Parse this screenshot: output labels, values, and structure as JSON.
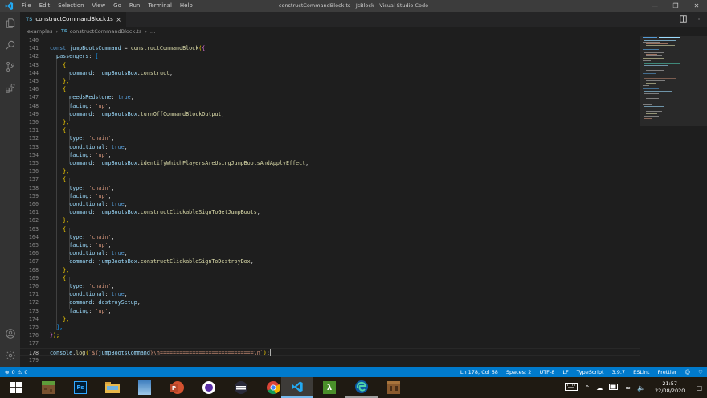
{
  "window": {
    "title": "constructCommandBlock.ts - JsBlock - Visual Studio Code",
    "menu": [
      "File",
      "Edit",
      "Selection",
      "View",
      "Go",
      "Run",
      "Terminal",
      "Help"
    ]
  },
  "tab": {
    "icon_text": "TS",
    "label": "constructCommandBlock.ts"
  },
  "breadcrumb": {
    "folder": "examples",
    "icon_text": "TS",
    "file": "constructCommandBlock.ts",
    "trail": "…"
  },
  "editor": {
    "lines": [
      {
        "n": "140"
      },
      {
        "n": "141"
      },
      {
        "n": "142"
      },
      {
        "n": "143"
      },
      {
        "n": "144"
      },
      {
        "n": "145"
      },
      {
        "n": "146"
      },
      {
        "n": "147"
      },
      {
        "n": "148"
      },
      {
        "n": "149"
      },
      {
        "n": "150"
      },
      {
        "n": "151"
      },
      {
        "n": "152"
      },
      {
        "n": "153"
      },
      {
        "n": "154"
      },
      {
        "n": "155"
      },
      {
        "n": "156"
      },
      {
        "n": "157"
      },
      {
        "n": "158"
      },
      {
        "n": "159"
      },
      {
        "n": "160"
      },
      {
        "n": "161"
      },
      {
        "n": "162"
      },
      {
        "n": "163"
      },
      {
        "n": "164"
      },
      {
        "n": "165"
      },
      {
        "n": "166"
      },
      {
        "n": "167"
      },
      {
        "n": "168"
      },
      {
        "n": "169"
      },
      {
        "n": "170"
      },
      {
        "n": "171"
      },
      {
        "n": "172"
      },
      {
        "n": "173"
      },
      {
        "n": "174"
      },
      {
        "n": "175"
      },
      {
        "n": "176"
      },
      {
        "n": "177"
      },
      {
        "n": "178"
      },
      {
        "n": "179"
      }
    ],
    "code": {
      "l141": {
        "a": "const",
        "b": "jumpBootsCommand",
        "c": " = ",
        "d": "constructCommandBlock",
        "e": "(",
        "f": "{"
      },
      "l142": {
        "a": "passengers",
        "b": ": ",
        "c": "["
      },
      "l143": {
        "a": "{"
      },
      "l144": {
        "a": "command",
        "b": ": ",
        "c": "jumpBootsBox",
        "d": ".",
        "e": "construct",
        "f": ","
      },
      "l145": {
        "a": "},"
      },
      "l146": {
        "a": "{"
      },
      "l147": {
        "a": "needsRedstone",
        "b": ": ",
        "c": "true",
        "d": ","
      },
      "l148": {
        "a": "facing",
        "b": ": ",
        "c": "'up'",
        "d": ","
      },
      "l149": {
        "a": "command",
        "b": ": ",
        "c": "jumpBootsBox",
        "d": ".",
        "e": "turnOffCommandBlockOutput",
        "f": ","
      },
      "l150": {
        "a": "},"
      },
      "l151": {
        "a": "{"
      },
      "l152": {
        "a": "type",
        "b": ": ",
        "c": "'chain'",
        "d": ","
      },
      "l153": {
        "a": "conditional",
        "b": ": ",
        "c": "true",
        "d": ","
      },
      "l154": {
        "a": "facing",
        "b": ": ",
        "c": "'up'",
        "d": ","
      },
      "l155": {
        "a": "command",
        "b": ": ",
        "c": "jumpBootsBox",
        "d": ".",
        "e": "identifyWhichPlayersAreUsingJumpBootsAndApplyEffect",
        "f": ","
      },
      "l156": {
        "a": "},"
      },
      "l157": {
        "a": "{"
      },
      "l158": {
        "a": "type",
        "b": ": ",
        "c": "'chain'",
        "d": ","
      },
      "l159": {
        "a": "facing",
        "b": ": ",
        "c": "'up'",
        "d": ","
      },
      "l160": {
        "a": "conditional",
        "b": ": ",
        "c": "true",
        "d": ","
      },
      "l161": {
        "a": "command",
        "b": ": ",
        "c": "jumpBootsBox",
        "d": ".",
        "e": "constructClickableSignToGetJumpBoots",
        "f": ","
      },
      "l162": {
        "a": "},"
      },
      "l163": {
        "a": "{"
      },
      "l164": {
        "a": "type",
        "b": ": ",
        "c": "'chain'",
        "d": ","
      },
      "l165": {
        "a": "facing",
        "b": ": ",
        "c": "'up'",
        "d": ","
      },
      "l166": {
        "a": "conditional",
        "b": ": ",
        "c": "true",
        "d": ","
      },
      "l167": {
        "a": "command",
        "b": ": ",
        "c": "jumpBootsBox",
        "d": ".",
        "e": "constructClickableSignToDestroyBox",
        "f": ","
      },
      "l168": {
        "a": "},"
      },
      "l169": {
        "a": "{"
      },
      "l170": {
        "a": "type",
        "b": ": ",
        "c": "'chain'",
        "d": ","
      },
      "l171": {
        "a": "conditional",
        "b": ": ",
        "c": "true",
        "d": ","
      },
      "l172": {
        "a": "command",
        "b": ": ",
        "c": "destroySetup",
        "d": ","
      },
      "l173": {
        "a": "facing",
        "b": ": ",
        "c": "'up'",
        "d": ","
      },
      "l174": {
        "a": "},"
      },
      "l175": {
        "a": "],"
      },
      "l176": {
        "a": "}",
        "b": ");"
      },
      "l178": {
        "a": "console",
        "b": ".",
        "c": "log",
        "d": "(",
        "e": "`${",
        "f": "jumpBootsCommand",
        "g": "}\\n=============================\\n`",
        "h": ")",
        "i": ";"
      }
    }
  },
  "statusbar": {
    "errors": "0",
    "warnings": "0",
    "position": "Ln 178, Col 68",
    "spaces": "Spaces: 2",
    "encoding": "UTF-8",
    "eol": "LF",
    "language": "TypeScript",
    "version": "3.9.7",
    "linter": "ESLint",
    "formatter": "Prettier"
  },
  "taskbar": {
    "time": "21:57",
    "date": "22/08/2020"
  },
  "colors": {
    "accent": "#007acc",
    "titlebar": "#3c3c3c",
    "activitybar": "#333333",
    "editor_bg": "#1e1e1e"
  }
}
